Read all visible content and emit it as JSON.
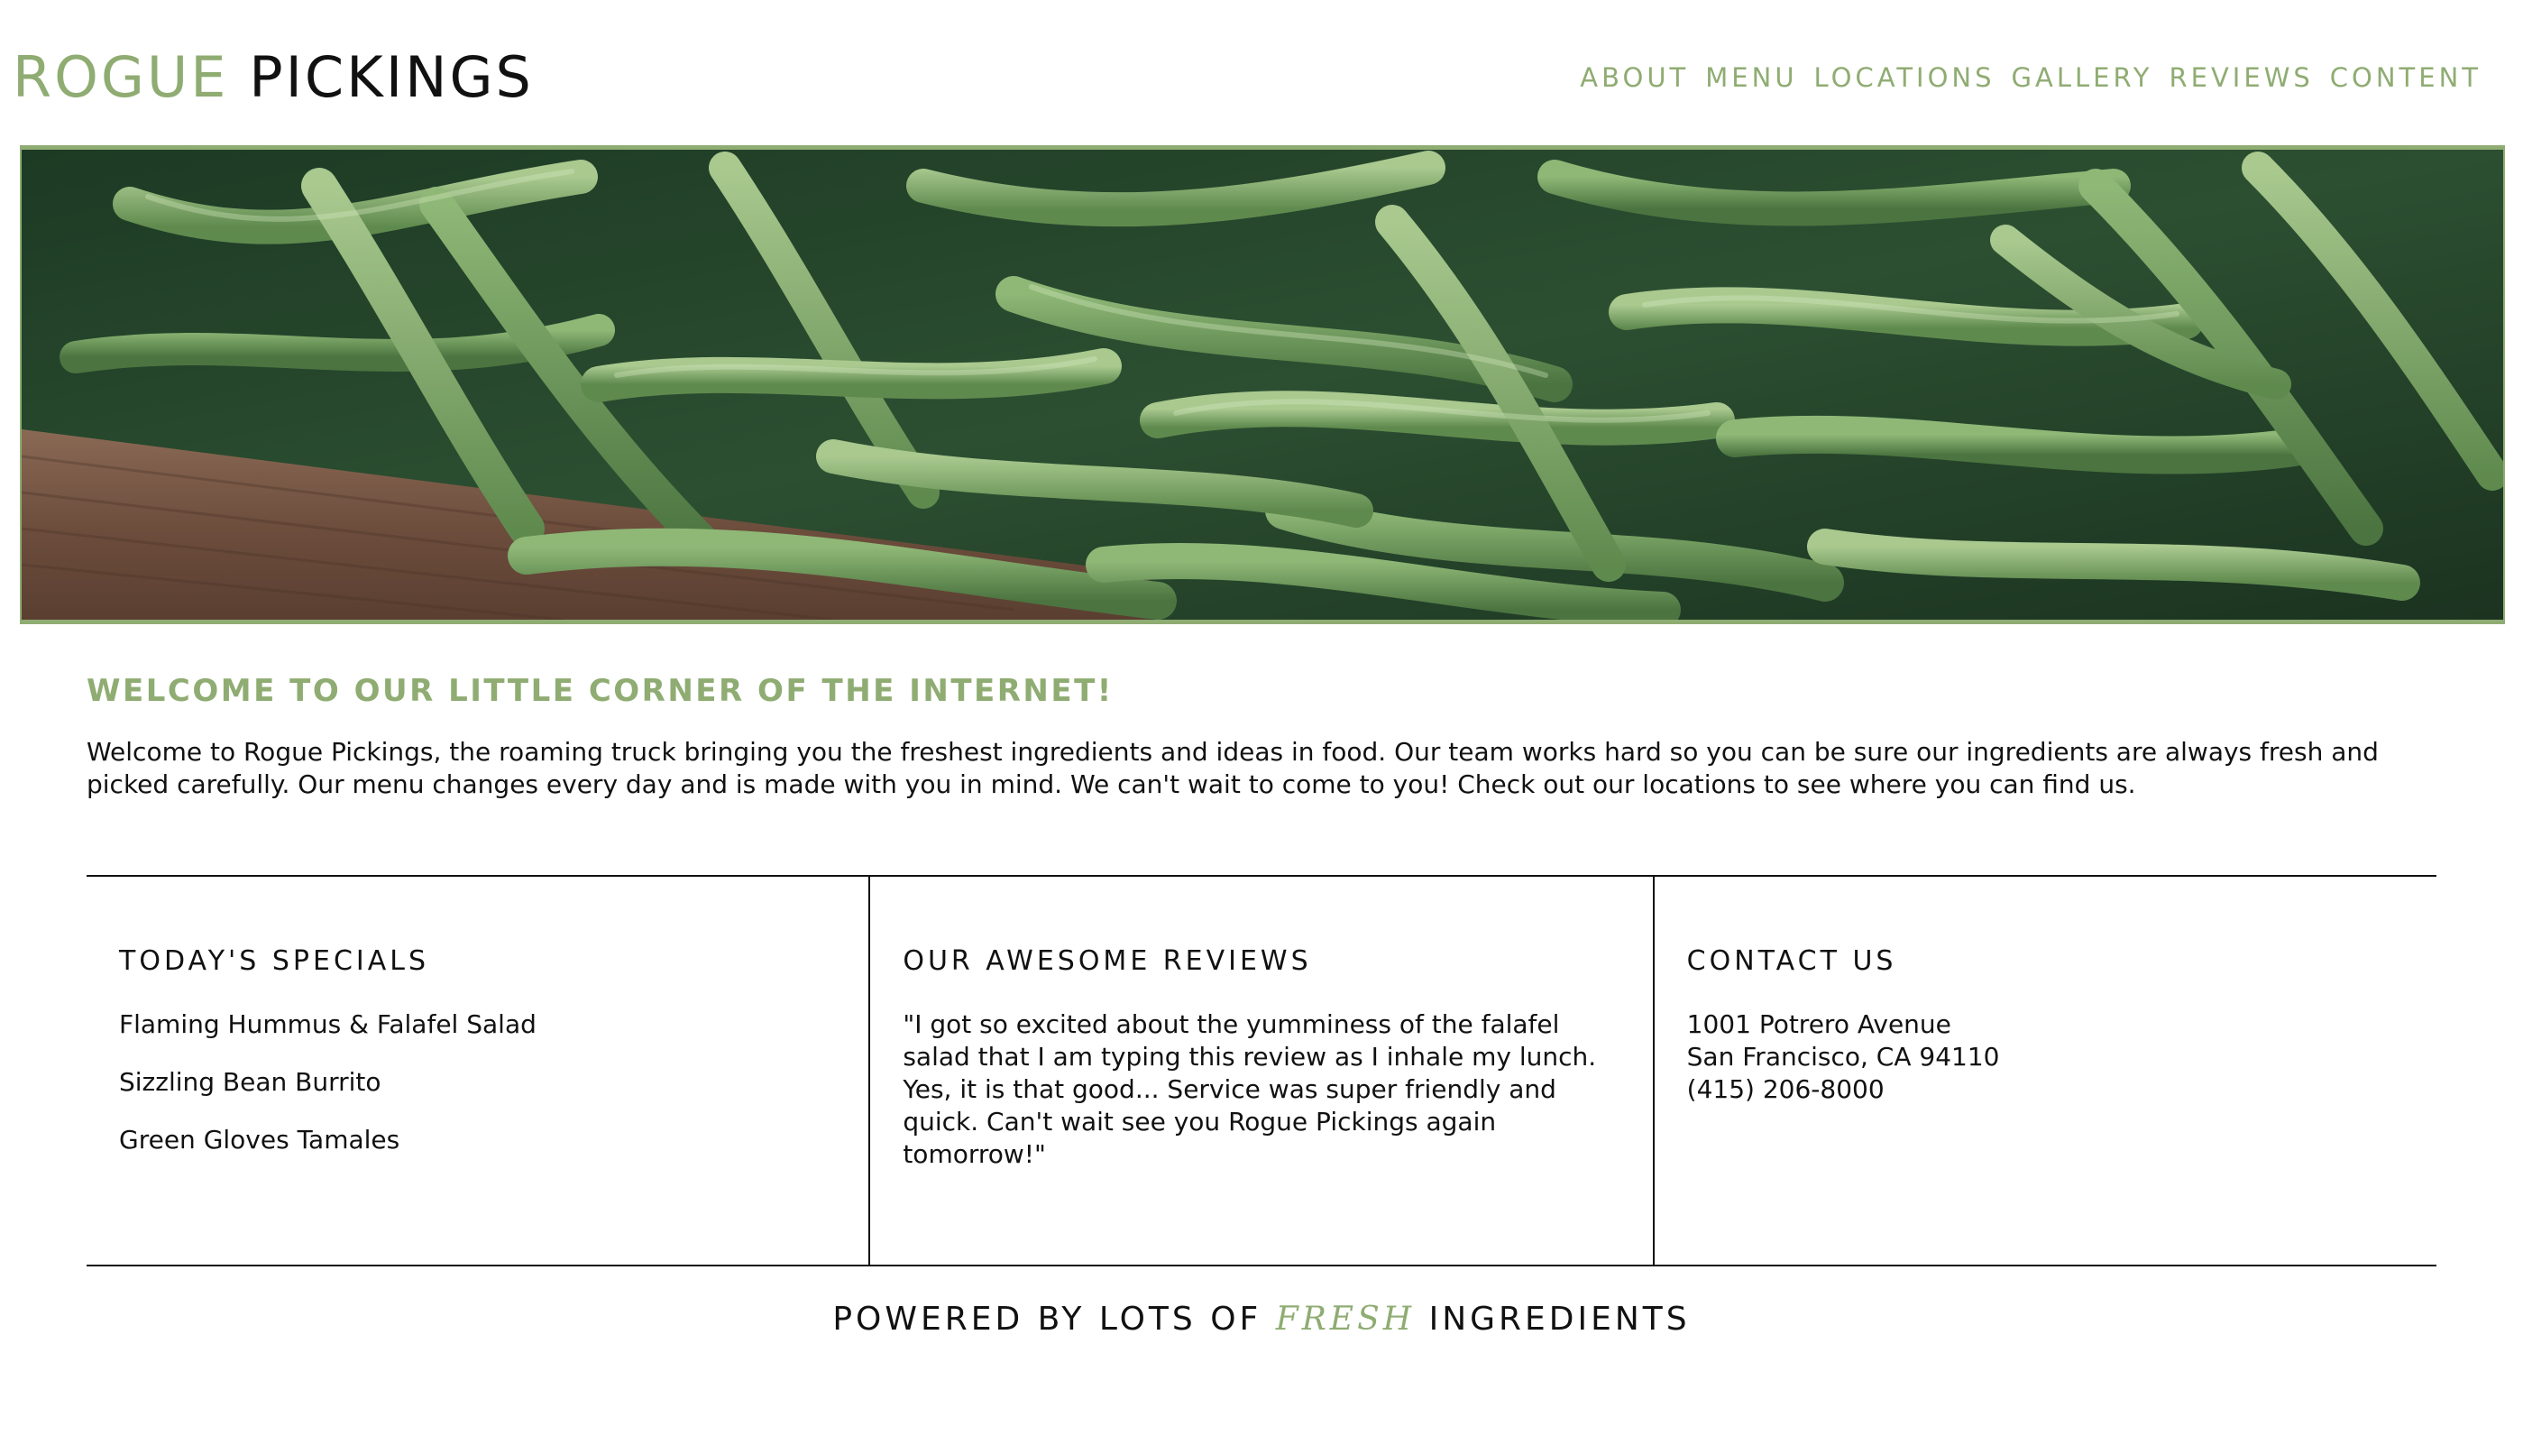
{
  "colors": {
    "accent": "#8fac72",
    "text": "#111111",
    "background": "#ffffff"
  },
  "header": {
    "logo_accent": "ROGUE",
    "logo_plain": "PICKINGS",
    "nav": [
      "ABOUT",
      "MENU",
      "LOCATIONS",
      "GALLERY",
      "REVIEWS",
      "CONTENT"
    ]
  },
  "hero": {
    "image": "green-beans-photo"
  },
  "welcome": {
    "title": "WELCOME TO OUR LITTLE CORNER OF THE INTERNET!",
    "text": "Welcome to Rogue Pickings, the roaming truck bringing you the freshest ingredients and ideas in food. Our team works hard so you can be sure our ingredients are always fresh and picked carefully. Our menu changes every day and is made with you in mind. We can't wait to come to you! Check out our locations to see where you can find us."
  },
  "specials": {
    "title": "TODAY'S SPECIALS",
    "items": [
      "Flaming Hummus & Falafel Salad",
      "Sizzling Bean Burrito",
      "Green Gloves Tamales"
    ]
  },
  "reviews": {
    "title": "OUR AWESOME REVIEWS",
    "quote": "\"I got so excited about the yumminess of the falafel salad that I am typing this review as I inhale my lunch. Yes, it is that good... Service was super friendly and quick. Can't wait see you Rogue Pickings again tomorrow!\""
  },
  "contact": {
    "title": "CONTACT US",
    "address_line1": "1001 Potrero Avenue",
    "address_line2": "San Francisco, CA 94110",
    "phone": "(415) 206-8000"
  },
  "footer": {
    "prefix": "POWERED BY LOTS OF",
    "highlight": "FRESH",
    "suffix": "INGREDIENTS"
  }
}
